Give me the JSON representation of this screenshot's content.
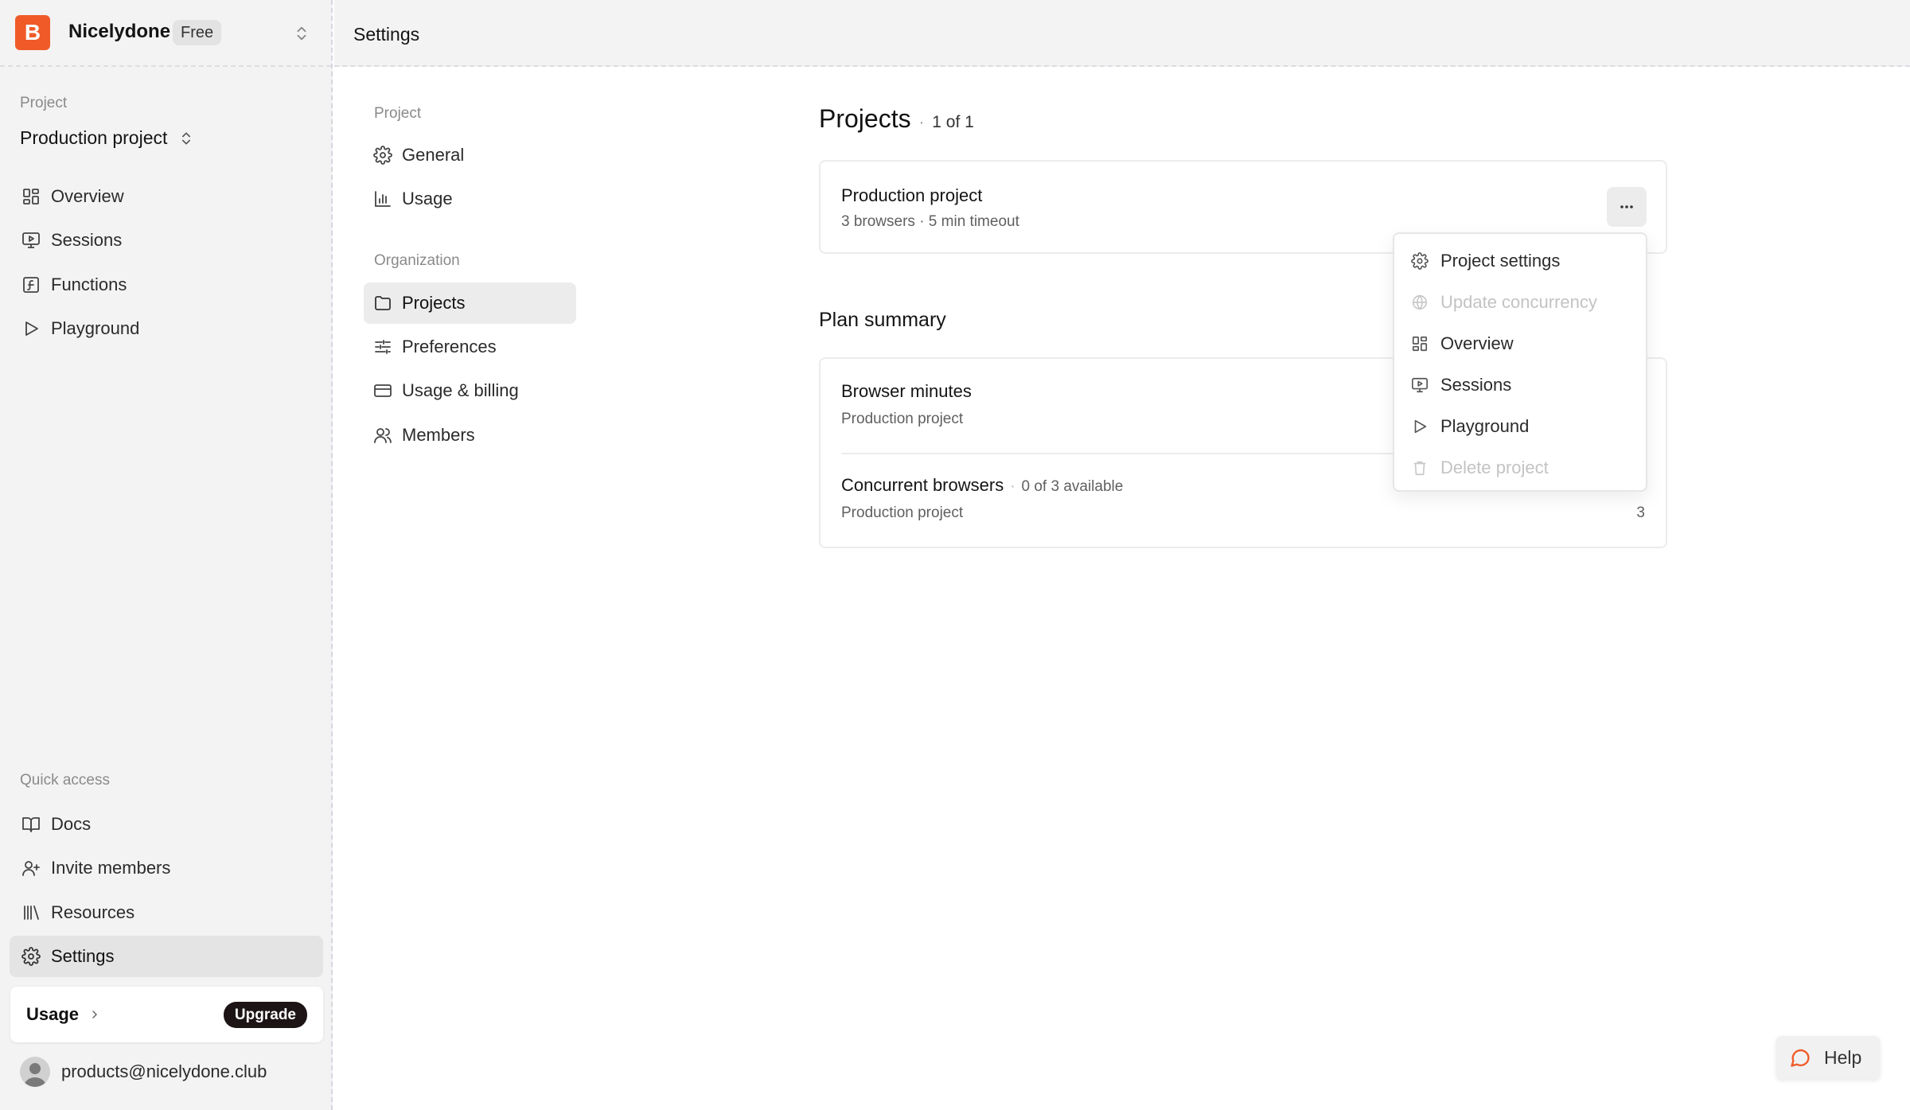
{
  "org": {
    "logo_letter": "B",
    "name": "Nicelydone",
    "plan": "Free",
    "brand_color": "#f05a28"
  },
  "sidebar": {
    "project_section_label": "Project",
    "current_project": "Production project",
    "nav": [
      {
        "label": "Overview",
        "icon": "grid-icon"
      },
      {
        "label": "Sessions",
        "icon": "monitor-play-icon"
      },
      {
        "label": "Functions",
        "icon": "function-icon"
      },
      {
        "label": "Playground",
        "icon": "play-icon"
      }
    ],
    "quick_access_label": "Quick access",
    "quick": [
      {
        "label": "Docs",
        "icon": "book-icon"
      },
      {
        "label": "Invite members",
        "icon": "user-plus-icon"
      },
      {
        "label": "Resources",
        "icon": "library-icon"
      },
      {
        "label": "Settings",
        "icon": "gear-icon",
        "active": true
      }
    ],
    "usage_label": "Usage",
    "upgrade_label": "Upgrade",
    "user_email": "products@nicelydone.club"
  },
  "topbar": {
    "title": "Settings"
  },
  "settings_nav": {
    "project_label": "Project",
    "project_items": [
      {
        "label": "General",
        "icon": "gear-icon"
      },
      {
        "label": "Usage",
        "icon": "bar-chart-icon"
      }
    ],
    "org_label": "Organization",
    "org_items": [
      {
        "label": "Projects",
        "icon": "folder-icon",
        "active": true
      },
      {
        "label": "Preferences",
        "icon": "sliders-icon"
      },
      {
        "label": "Usage & billing",
        "icon": "credit-card-icon"
      },
      {
        "label": "Members",
        "icon": "users-icon"
      }
    ]
  },
  "projects": {
    "title": "Projects",
    "separator": "·",
    "count": "1 of 1",
    "items": [
      {
        "name": "Production project",
        "meta": "3 browsers · 5 min timeout"
      }
    ]
  },
  "plan_summary": {
    "title": "Plan summary",
    "rows": [
      {
        "title": "Browser minutes",
        "sub": "Production project"
      },
      {
        "title": "Concurrent browsers",
        "inline": "0 of 3 available",
        "sub": "Production project",
        "value": "3"
      }
    ]
  },
  "menu": {
    "items": [
      {
        "label": "Project settings",
        "icon": "gear-icon",
        "disabled": false
      },
      {
        "label": "Update concurrency",
        "icon": "globe-icon",
        "disabled": true
      },
      {
        "label": "Overview",
        "icon": "grid-icon",
        "disabled": false
      },
      {
        "label": "Sessions",
        "icon": "monitor-play-icon",
        "disabled": false
      },
      {
        "label": "Playground",
        "icon": "play-icon",
        "disabled": false
      },
      {
        "label": "Delete project",
        "icon": "trash-icon",
        "disabled": true
      }
    ]
  },
  "help": {
    "label": "Help",
    "accent": "#f05a28"
  }
}
